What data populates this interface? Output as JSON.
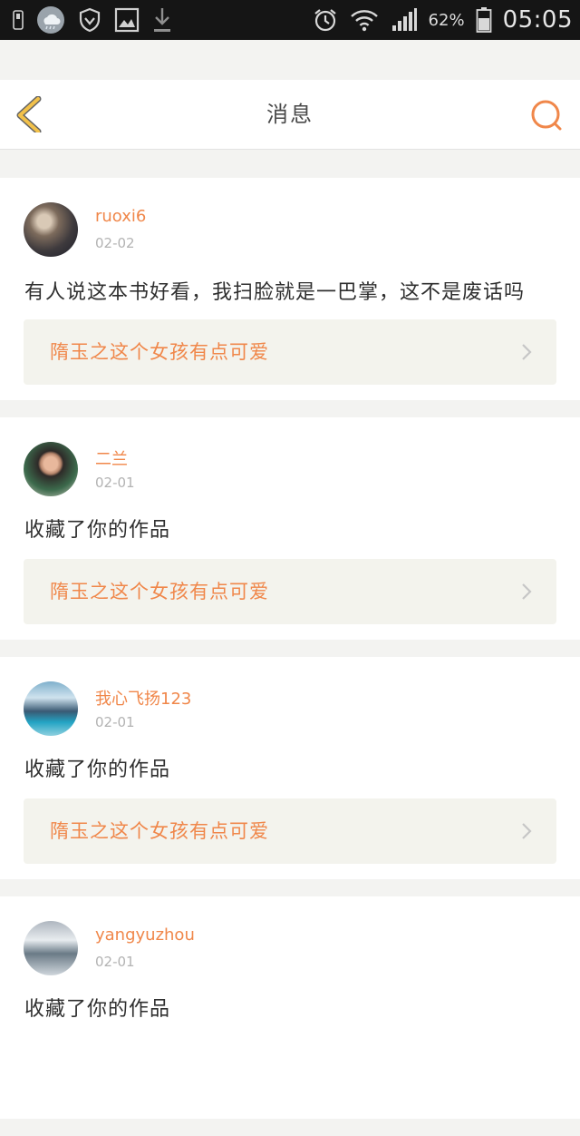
{
  "status_bar": {
    "battery_percent": "62%",
    "time": "05:05",
    "icons": [
      "sim-icon",
      "weather-icon",
      "shield-icon",
      "image-icon",
      "download-icon",
      "alarm-icon",
      "wifi-icon",
      "signal-icon",
      "battery-icon"
    ]
  },
  "header": {
    "title": "消息",
    "back_icon": "chevron-left-icon",
    "search_icon": "search-icon"
  },
  "colors": {
    "accent": "#f0874a",
    "back_icon": "#f2c14a",
    "background": "#f3f3f1"
  },
  "messages": [
    {
      "username": "ruoxi6",
      "date": "02-02",
      "text": "有人说这本书好看，我扫脸就是一巴掌，这不是废话吗",
      "work_title": "隋玉之这个女孩有点可爱"
    },
    {
      "username": "二兰",
      "date": "02-01",
      "text": "收藏了你的作品",
      "work_title": "隋玉之这个女孩有点可爱"
    },
    {
      "username": "我心飞扬123",
      "date": "02-01",
      "text": "收藏了你的作品",
      "work_title": "隋玉之这个女孩有点可爱"
    },
    {
      "username": "yangyuzhou",
      "date": "02-01",
      "text": "收藏了你的作品",
      "work_title": ""
    }
  ]
}
